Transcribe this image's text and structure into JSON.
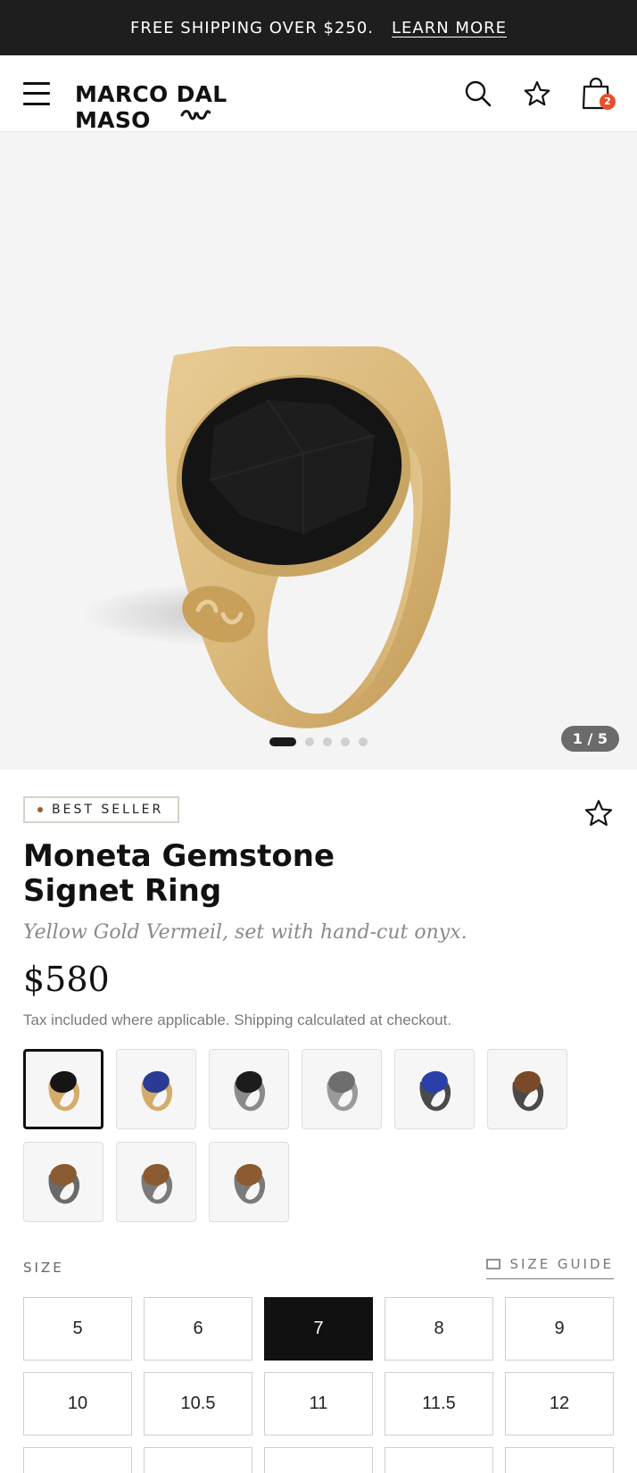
{
  "announcement": {
    "text": "FREE SHIPPING OVER $250.",
    "link": "LEARN MORE"
  },
  "header": {
    "brand": "MARCO DAL MASO",
    "icons": [
      "menu-icon",
      "search-icon",
      "star-icon",
      "bag-icon"
    ],
    "cart_count": "2"
  },
  "gallery": {
    "counter": "1 / 5",
    "dot_count": 5,
    "active_dot": 0,
    "background": "#f4f4f4"
  },
  "product": {
    "badge": "BEST SELLER",
    "title": "Moneta Gemstone Signet Ring",
    "subtitle": "Yellow Gold Vermeil, set with hand-cut onyx.",
    "price": "$580",
    "tax_note": "Tax included where applicable. Shipping calculated at checkout."
  },
  "variants": [
    {
      "metal": "#d3ac6a",
      "stone": "#151515",
      "active": true
    },
    {
      "metal": "#d3ac6a",
      "stone": "#2b3b94",
      "active": false
    },
    {
      "metal": "#8a8a8a",
      "stone": "#1c1c1c",
      "active": false
    },
    {
      "metal": "#9a9a9a",
      "stone": "#6e6e6e",
      "active": false
    },
    {
      "metal": "#4a4a4a",
      "stone": "#2a3fa8",
      "active": false
    },
    {
      "metal": "#4a4a4a",
      "stone": "#7a4a28",
      "active": false
    },
    {
      "metal": "#6a6a6a",
      "stone": "#8a5a30",
      "active": false
    },
    {
      "metal": "#7a7a7a",
      "stone": "#8a5a30",
      "active": false
    },
    {
      "metal": "#7a7a7a",
      "stone": "#8a5a30",
      "active": false
    }
  ],
  "size": {
    "label": "SIZE",
    "guide": "SIZE GUIDE",
    "options": [
      "5",
      "6",
      "7",
      "8",
      "9",
      "10",
      "10.5",
      "11",
      "11.5",
      "12",
      "",
      "",
      "",
      "",
      ""
    ],
    "selected": "7"
  },
  "colors": {
    "accent": "#111111",
    "badge_dot": "#a05a2c",
    "cart_badge": "#e5502d"
  }
}
